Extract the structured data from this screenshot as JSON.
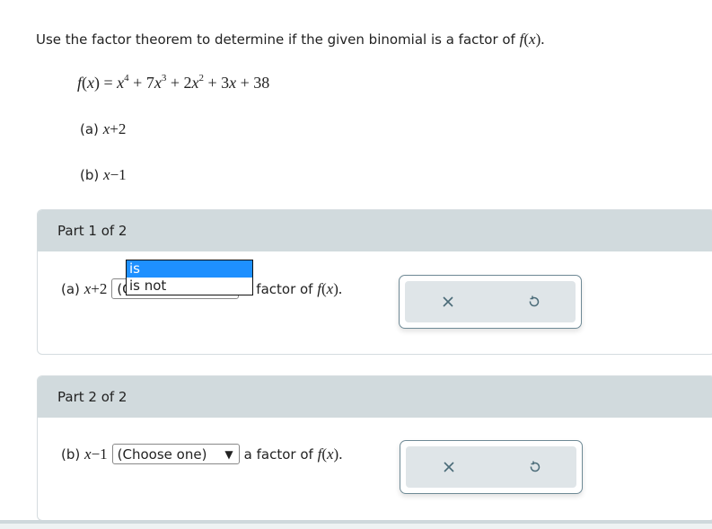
{
  "question": {
    "prompt": "Use the factor theorem to determine if the given binomial is a factor of",
    "prompt_fx": "f(x).",
    "function_definition": {
      "lhs": "f(x)",
      "terms": [
        "x⁴",
        "7x³",
        "2x²",
        "3x",
        "38"
      ],
      "display": "f(x) = x^4 + 7x^3 + 2x^2 + 3x + 38"
    },
    "choices": [
      {
        "label": "(a)",
        "binomial": "x+2"
      },
      {
        "label": "(b)",
        "binomial": "x−1"
      }
    ]
  },
  "parts": [
    {
      "header": "Part 1 of 2",
      "label": "(a)",
      "binomial": "x+2",
      "select_value": "(Choose one)",
      "suffix": "a factor of",
      "suffix_fx": "f(x).",
      "dropdown_open": true,
      "options": [
        {
          "label": "is",
          "highlighted": true
        },
        {
          "label": "is not",
          "highlighted": false
        }
      ],
      "buttons": {
        "clear": "close-icon",
        "reset": "undo-icon"
      }
    },
    {
      "header": "Part 2 of 2",
      "label": "(b)",
      "binomial": "x−1",
      "select_value": "(Choose one)",
      "suffix": "a factor of",
      "suffix_fx": "f(x).",
      "dropdown_open": false,
      "buttons": {
        "clear": "close-icon",
        "reset": "undo-icon"
      }
    }
  ],
  "colors": {
    "part_header_bg": "#d1dadd",
    "button_bg": "#dfe5e8",
    "icon_color": "#4a6b78",
    "option_highlight": "#1e90ff"
  }
}
